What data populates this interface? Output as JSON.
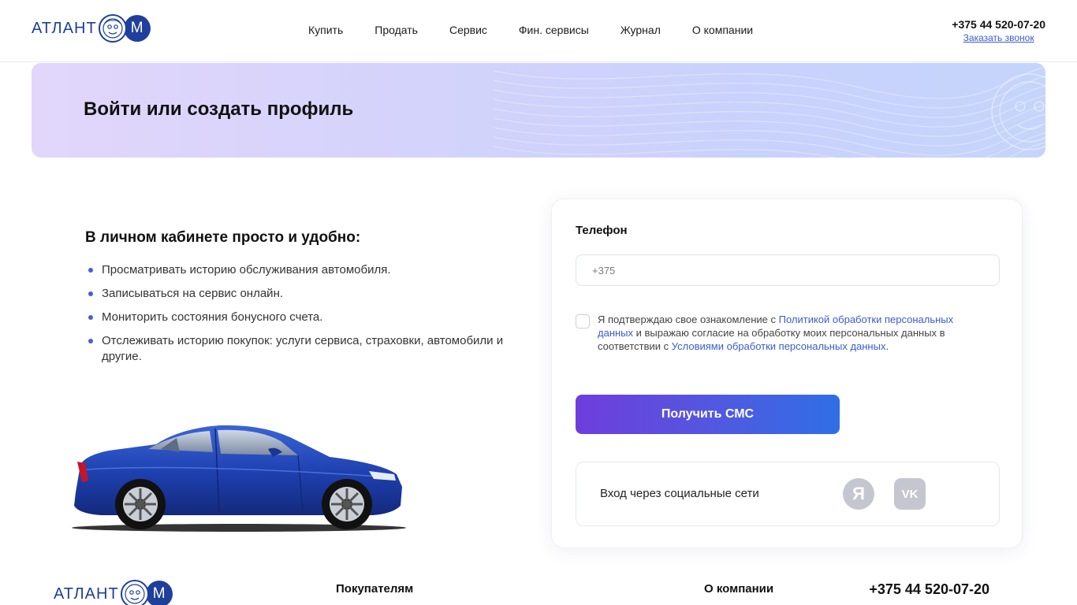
{
  "header": {
    "logo": {
      "left_text": "АТЛАНТ",
      "right_text": "М"
    },
    "nav": [
      "Купить",
      "Продать",
      "Сервис",
      "Фин. сервисы",
      "Журнал",
      "О компании"
    ],
    "phone": "+375 44 520-07-20",
    "callback_label": "Заказать звонок"
  },
  "banner": {
    "title": "Войти или создать профиль"
  },
  "benefits": {
    "title": "В личном кабинете просто и удобно:",
    "items": [
      "Просматривать историю обслуживания автомобиля.",
      "Записываться на сервис онлайн.",
      "Мониторить состояния бонусного счета.",
      "Отслеживать историю покупок: услуги сервиса, страховки, автомобили и другие."
    ]
  },
  "login": {
    "phone_label": "Телефон",
    "phone_placeholder": "+375",
    "consent": {
      "part1": "Я подтверждаю свое ознакомление с ",
      "link1": "Политикой обработки персональных данных",
      "part2": " и выражаю согласие на обработку моих персональных данных в соответствии с ",
      "link2": "Условиями обработки персональных данных",
      "part3": "."
    },
    "submit_label": "Получить СМС",
    "social_label": "Вход через социальные сети",
    "social": {
      "yandex": "Я",
      "vk": "VK"
    }
  },
  "footer": {
    "logo": {
      "left_text": "АТЛАНТ",
      "right_text": "М"
    },
    "col_buyers": "Покупателям",
    "col_company": "О компании",
    "phone": "+375 44 520-07-20"
  },
  "colors": {
    "brand": "#1f3f9c",
    "accent_link": "#3a5bd0",
    "button_start": "#6f3ddc",
    "button_end": "#2f6fe6",
    "bullet": "#4a5bdc"
  }
}
